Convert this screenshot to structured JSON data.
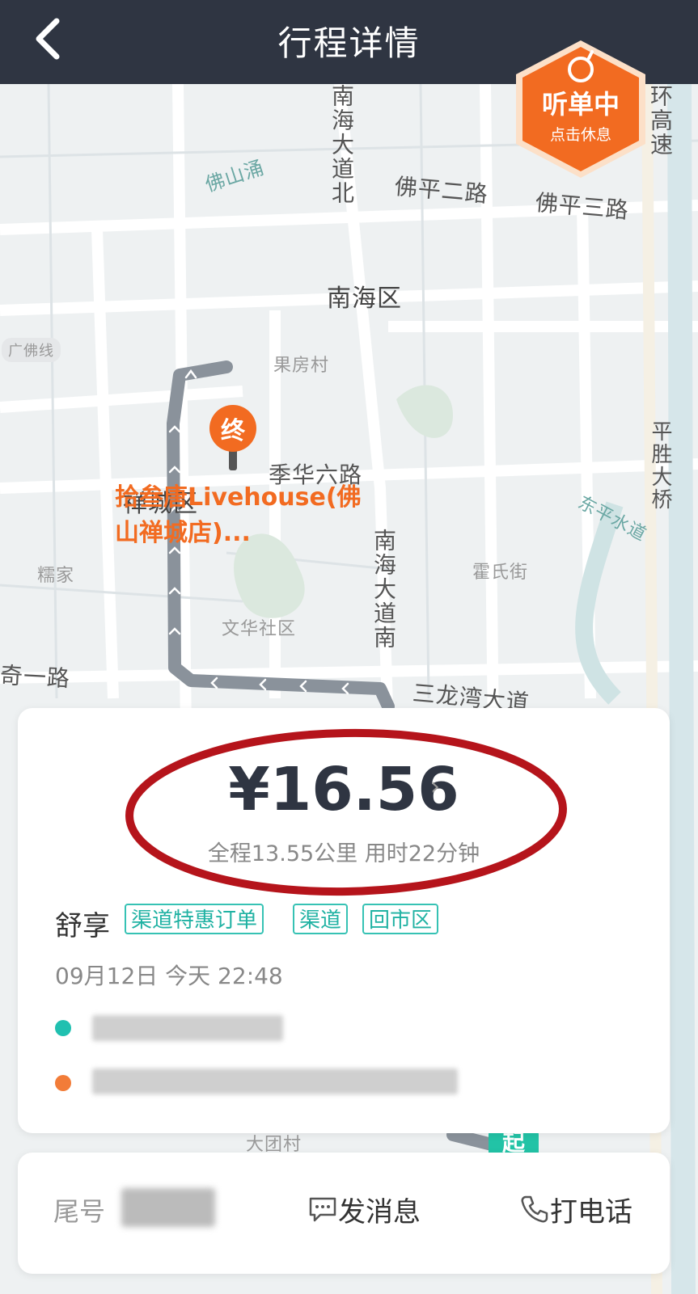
{
  "header": {
    "title": "行程详情"
  },
  "listen_badge": {
    "title": "听单中",
    "subtitle": "点击休息"
  },
  "map": {
    "labels": {
      "nanhai_north": "南海大道北",
      "foshan_yong": "佛山涌",
      "fuping2": "佛平二路",
      "fuping3": "佛平三路",
      "ring_highway": "环高速",
      "nanhai_district": "南海区",
      "guangfo_line": "广佛线",
      "guofang": "果房村",
      "lihua6": "季华六路",
      "chancheng": "禅城区",
      "nanhai_south": "南海大道南",
      "pingsheng": "平胜大桥",
      "dongping": "东平水道",
      "nuojia": "糯家",
      "huoshi": "霍氏街",
      "wenhua": "文华社区",
      "qiyi": "奇一路",
      "sanlongwan": "三龙湾大道",
      "daguo": "大团村"
    },
    "start_marker": "起",
    "end_marker": "终",
    "destination_label": "拾叁唐Livehouse(佛山禅城店)..."
  },
  "trip": {
    "price": "¥16.56",
    "summary": "全程13.55公里 用时22分钟",
    "car_type": "舒享",
    "tags": [
      "渠道特惠订单",
      "渠道",
      "回市区"
    ],
    "datetime": "09月12日 今天 22:48"
  },
  "bottom": {
    "tail_label": "尾号",
    "message_label": "发消息",
    "call_label": "打电话"
  },
  "colors": {
    "header_bg": "#2f3542",
    "accent_orange": "#f26b21",
    "teal": "#20b2a3",
    "annotation_red": "#b5141b"
  }
}
